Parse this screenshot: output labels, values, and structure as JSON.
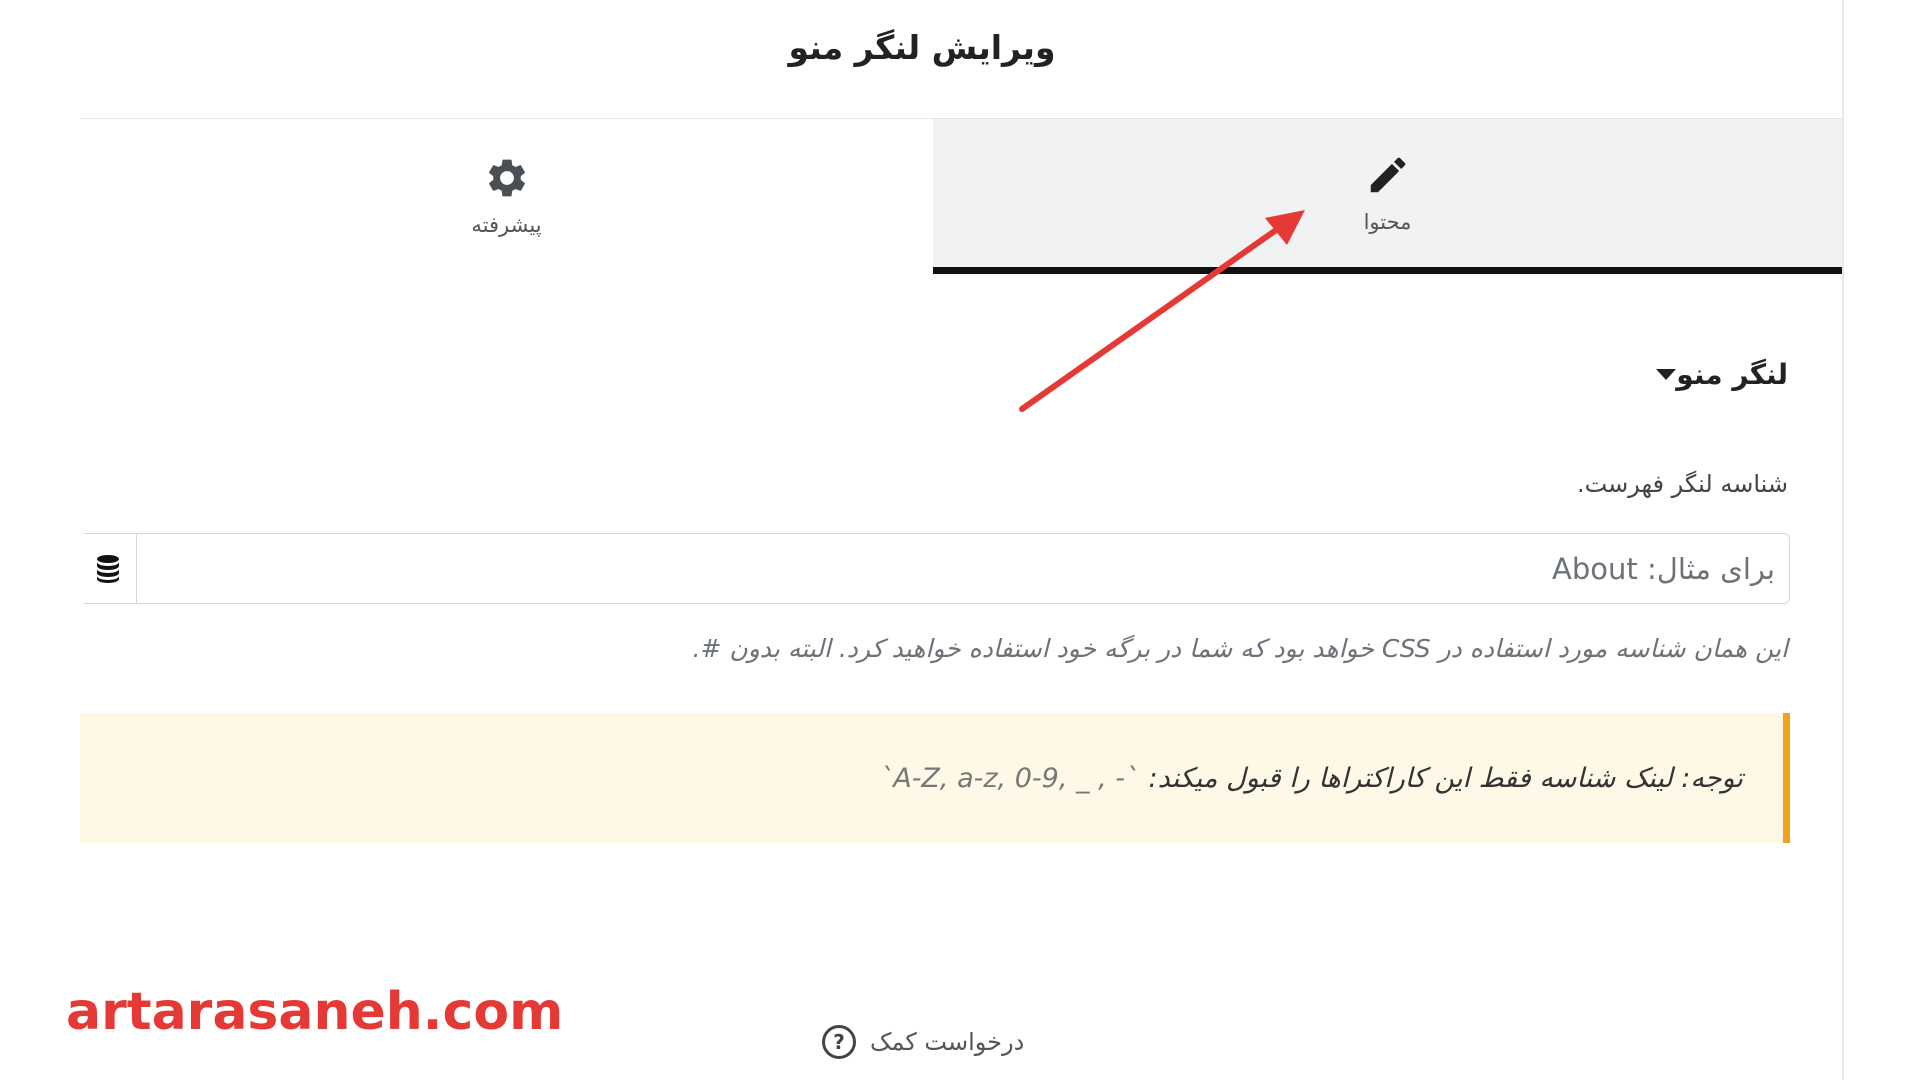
{
  "panel": {
    "title": "ویرایش لنگر منو"
  },
  "tabs": [
    {
      "label": "پیشرفته",
      "icon": "gear-icon"
    },
    {
      "label": "محتوا",
      "icon": "pencil-icon",
      "active": true
    }
  ],
  "section": {
    "title": "لنگر منو"
  },
  "field": {
    "label": "شناسه لنگر فهرست.",
    "placeholder": "برای مثال: About",
    "dynamic_icon": "database-icon"
  },
  "help_text": "این همان شناسه مورد استفاده در CSS خواهد بود که شما در برگه خود استفاده خواهید کرد. البته بدون #.",
  "notice": {
    "prefix": "توجه: لینک شناسه فقط این کاراکتراها را قبول میکند:",
    "chars": "`A-Z, a-z, 0-9, _ , -`"
  },
  "footer": {
    "help_label": "درخواست کمک"
  },
  "watermark": "artarasaneh.com",
  "colors": {
    "accent_arrow": "#e53935",
    "notice_bg": "#fef9e6",
    "notice_border": "#f0a21b",
    "active_tab_bg": "#f1f2f3"
  }
}
